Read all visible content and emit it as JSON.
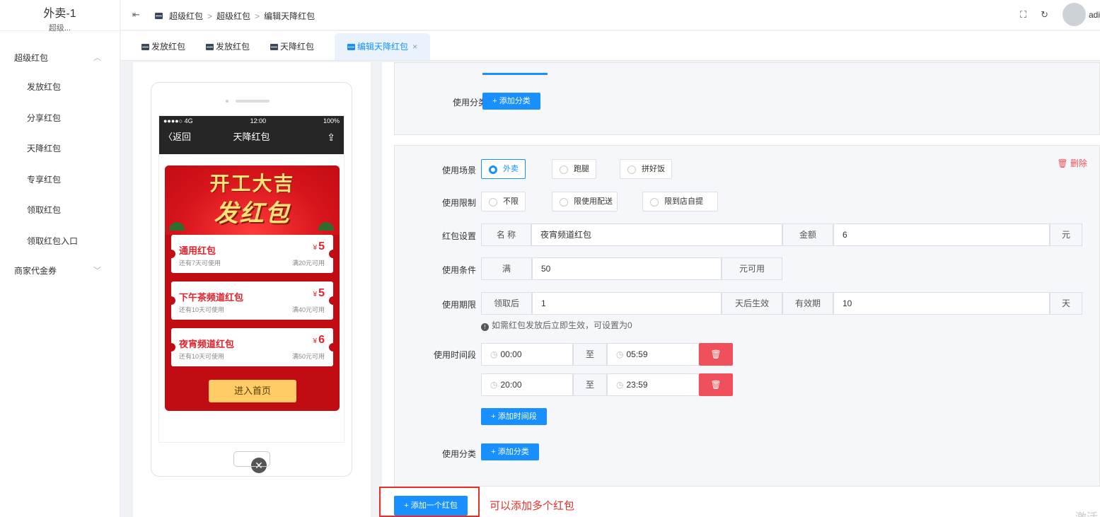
{
  "sidebar": {
    "brand_title": "外卖-1",
    "brand_sub": "超级...",
    "groups": [
      {
        "label": "超级红包",
        "items": [
          "发放红包",
          "分享红包",
          "天降红包",
          "专享红包",
          "领取红包",
          "领取红包入口"
        ]
      },
      {
        "label": "商家代金券"
      }
    ]
  },
  "header": {
    "breadcrumbs": [
      "超级红包",
      "超级红包",
      "编辑天降红包"
    ],
    "user": "adi"
  },
  "tabs": [
    {
      "label": "发放红包"
    },
    {
      "label": "发放红包"
    },
    {
      "label": "天降红包"
    },
    {
      "label": "编辑天降红包",
      "active": true,
      "close": "×"
    }
  ],
  "preview": {
    "status_left": "●●●●○ 4G",
    "status_time": "12:00",
    "status_battery": "100%",
    "nav_back": "〈返回",
    "nav_title": "天降红包",
    "poster_line1": "开工大吉",
    "poster_line2": "发红包",
    "coupons": [
      {
        "name": "通用红包",
        "currency": "¥",
        "amount": "5",
        "validity": "还有7天可使用",
        "condition": "满20元可用"
      },
      {
        "name": "下午茶频道红包",
        "currency": "¥",
        "amount": "5",
        "validity": "还有10天可使用",
        "condition": "满40元可用"
      },
      {
        "name": "夜宵频道红包",
        "currency": "¥",
        "amount": "6",
        "validity": "还有10天可使用",
        "condition": "满50元可用"
      }
    ],
    "enter_button": "进入首页"
  },
  "form": {
    "top_card": {
      "category_label": "使用分类",
      "add_category": "+ 添加分类"
    },
    "card": {
      "delete": "删除",
      "scene_label": "使用场景",
      "scenes": [
        {
          "label": "外卖",
          "checked": true
        },
        {
          "label": "跑腿",
          "checked": false
        },
        {
          "label": "拼好饭",
          "checked": false
        }
      ],
      "limit_label": "使用限制",
      "limits": [
        {
          "label": "不限",
          "checked": false
        },
        {
          "label": "限使用配送",
          "checked": false
        },
        {
          "label": "限到店自提",
          "checked": false
        }
      ],
      "packet_label": "红包设置",
      "name_addon": "名 称",
      "name_value": "夜宵频道红包",
      "amount_addon": "金额",
      "amount_value": "6",
      "amount_unit": "元",
      "cond_label": "使用条件",
      "cond_prefix": "满",
      "cond_value": "50",
      "cond_suffix": "元可用",
      "period_label": "使用期限",
      "period_prefix": "领取后",
      "period_value": "1",
      "period_mid": "天后生效",
      "valid_addon": "有效期",
      "valid_value": "10",
      "valid_unit": "天",
      "hint": "如需红包发放后立即生效，可设置为0",
      "time_label": "使用时间段",
      "time_sep": "至",
      "times": [
        {
          "start": "00:00",
          "end": "05:59"
        },
        {
          "start": "20:00",
          "end": "23:59"
        }
      ],
      "add_time": "+ 添加时间段",
      "category_label": "使用分类",
      "add_category": "+ 添加分类"
    },
    "add_packet": "+ 添加一个红包",
    "annotation": "可以添加多个红包"
  },
  "watermark": "激活 Windows",
  "colors": {
    "primary": "#1890ff",
    "danger": "#f0505c",
    "poster": "#c20c13",
    "annotation": "#e5302a"
  }
}
